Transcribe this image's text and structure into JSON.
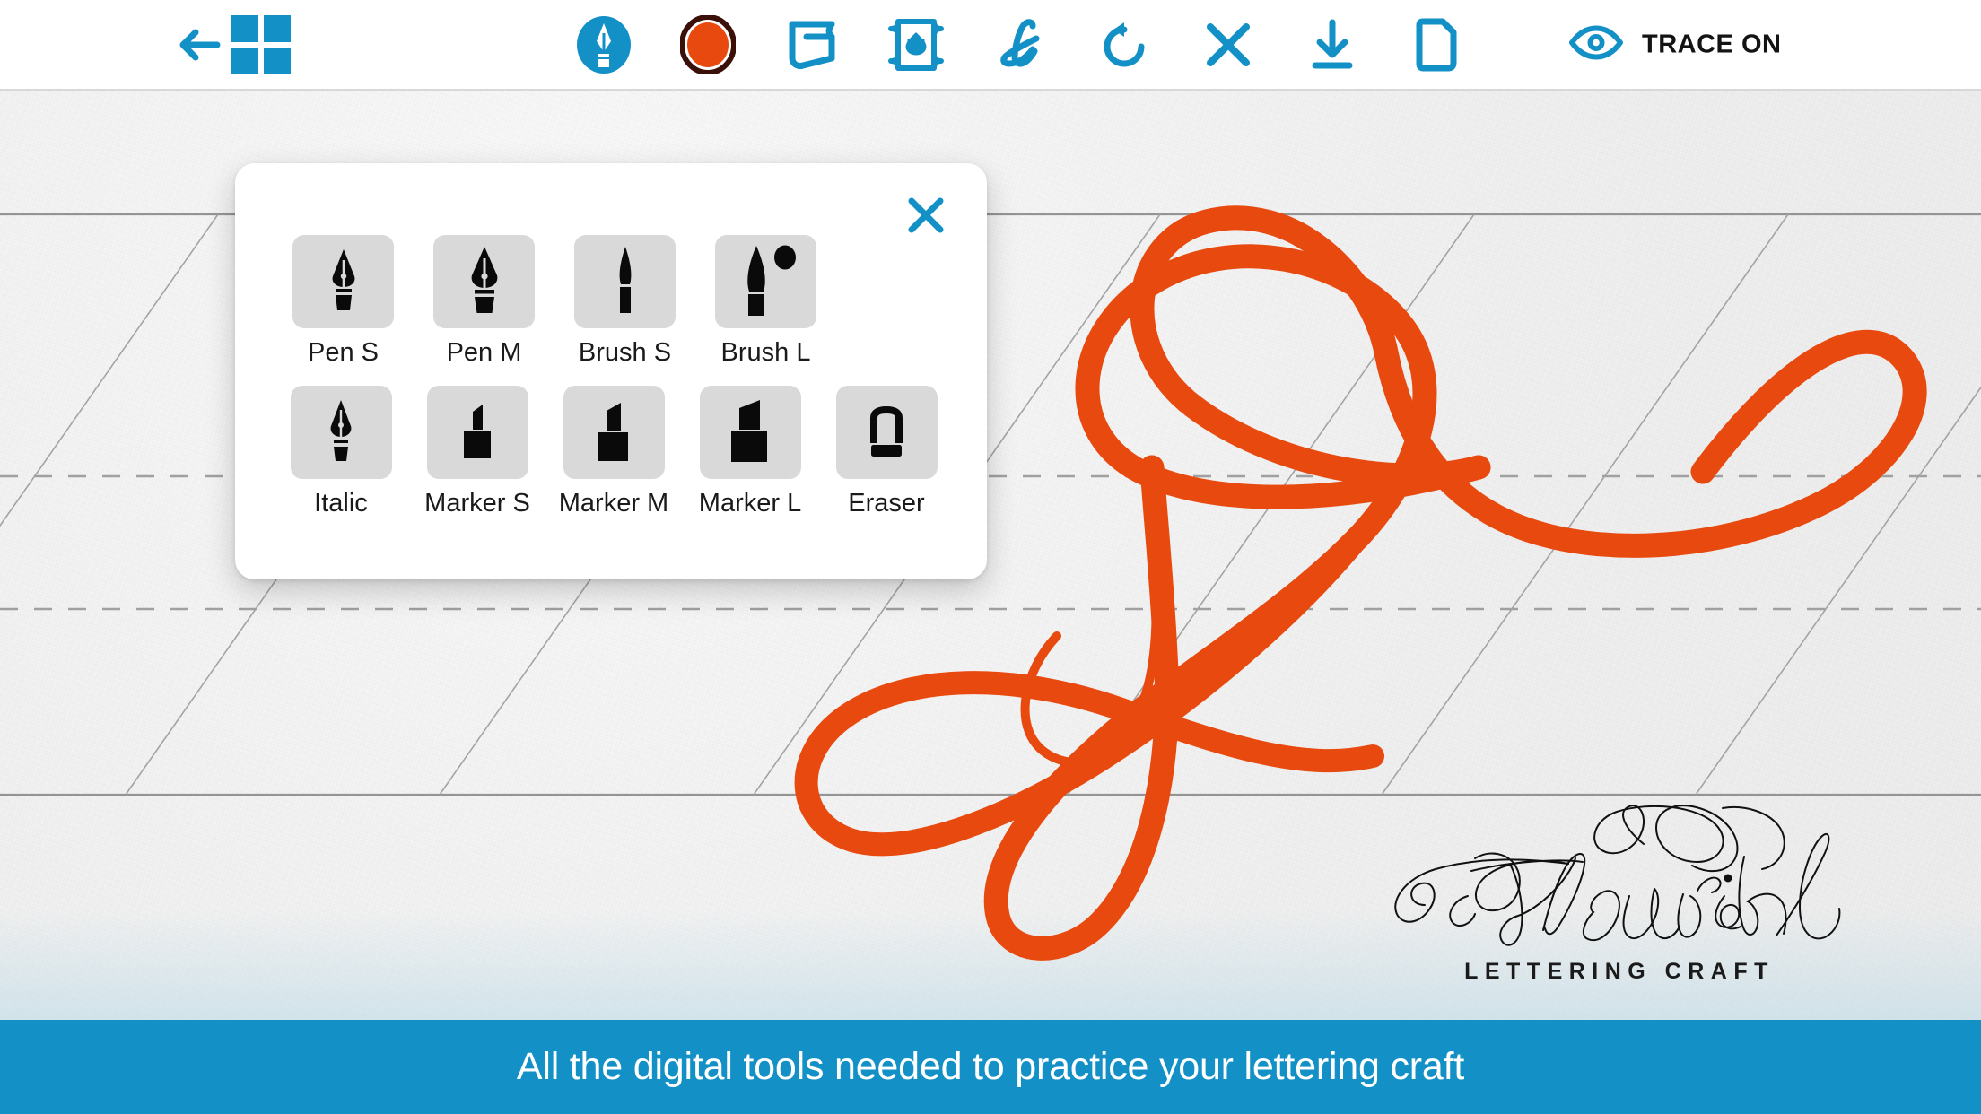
{
  "header": {
    "back_icon": "back-arrow-icon",
    "gallery_icon": "grid-squares-icon",
    "tools": [
      {
        "name": "nib-pen-tool",
        "icon": "pen-nib-circle-icon",
        "label": "Pen Tool",
        "active": true
      },
      {
        "name": "ink-color-tool",
        "icon": "ink-color-circle-icon",
        "label": "Ink Color",
        "color": "#e8490f",
        "ring": "#3a1008"
      },
      {
        "name": "paper-tool",
        "icon": "paper-sheet-icon",
        "label": "Paper"
      },
      {
        "name": "guides-tool",
        "icon": "guide-card-icon",
        "label": "Guides"
      },
      {
        "name": "script-tool",
        "icon": "script-l-icon",
        "label": "Script"
      },
      {
        "name": "undo-tool",
        "icon": "undo-rotate-icon",
        "label": "Undo"
      },
      {
        "name": "clear-tool",
        "icon": "close-x-icon",
        "label": "Clear"
      },
      {
        "name": "save-tool",
        "icon": "download-arrow-icon",
        "label": "Save"
      },
      {
        "name": "new-page-tool",
        "icon": "document-page-icon",
        "label": "New Page"
      }
    ],
    "trace": {
      "icon": "eye-icon",
      "label": "TRACE ON",
      "state": "on"
    }
  },
  "palette": {
    "close_icon": "close-x-icon",
    "rows": [
      [
        {
          "label": "Pen S",
          "icon": "pen-nib-small-icon"
        },
        {
          "label": "Pen M",
          "icon": "pen-nib-medium-icon"
        },
        {
          "label": "Brush S",
          "icon": "brush-small-icon"
        },
        {
          "label": "Brush L",
          "icon": "brush-large-icon"
        }
      ],
      [
        {
          "label": "Italic",
          "icon": "italic-nib-icon"
        },
        {
          "label": "Marker S",
          "icon": "marker-small-icon"
        },
        {
          "label": "Marker M",
          "icon": "marker-medium-icon"
        },
        {
          "label": "Marker L",
          "icon": "marker-large-icon"
        },
        {
          "label": "Eraser",
          "icon": "eraser-icon"
        }
      ]
    ]
  },
  "canvas": {
    "letter": "Y",
    "ink_color": "#e8490f",
    "guides": {
      "solid_line_color": "#8d8d8d",
      "dashed_line_color": "#9a9a9a",
      "slant_line_color": "#9b9b9b",
      "slant_angle_deg": 55
    }
  },
  "logo": {
    "script_text": "Flourish",
    "subtitle": "LETTERING CRAFT"
  },
  "banner": {
    "text": "All the digital tools needed to practice your lettering craft",
    "background": "#1391c7"
  },
  "colors": {
    "accent_blue": "#1391c7",
    "ink_orange": "#e8490f",
    "paper": "#f1f1f1"
  }
}
